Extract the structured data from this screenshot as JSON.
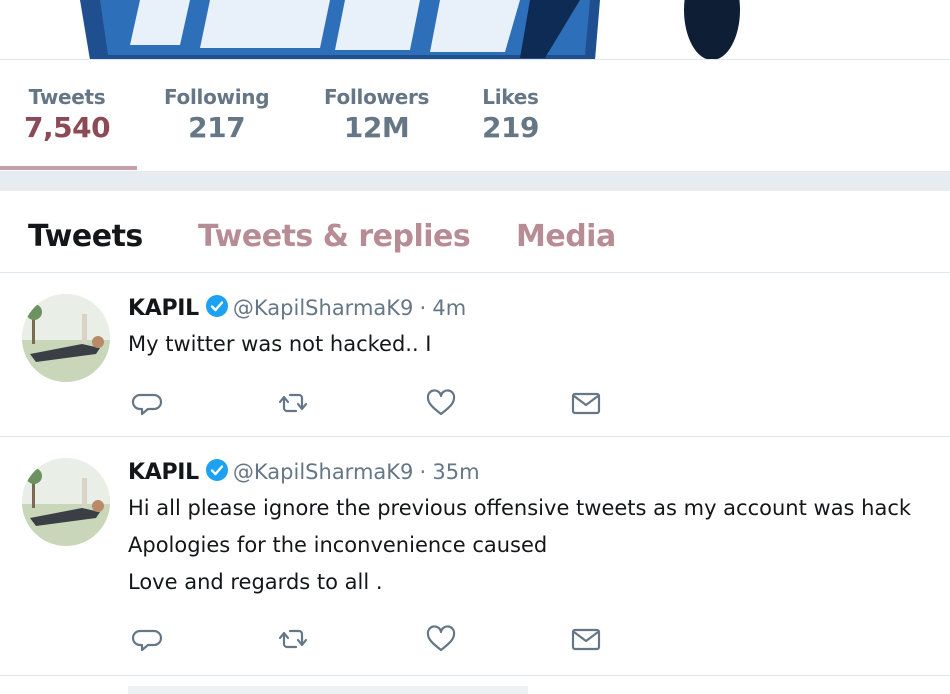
{
  "banner": {
    "alt": "profile header banner"
  },
  "stats": [
    {
      "label": "Tweets",
      "value": "7,540",
      "active": true
    },
    {
      "label": "Following",
      "value": "217",
      "active": false
    },
    {
      "label": "Followers",
      "value": "12M",
      "active": false
    },
    {
      "label": "Likes",
      "value": "219",
      "active": false
    }
  ],
  "tabs": [
    {
      "label": "Tweets",
      "active": true
    },
    {
      "label": "Tweets & replies",
      "active": false
    },
    {
      "label": "Media",
      "active": false
    }
  ],
  "tweets": [
    {
      "name": "KAPIL",
      "handle": "@KapilSharmaK9",
      "separator": "·",
      "time": "4m",
      "lines": [
        "My twitter was not hacked.. I"
      ]
    },
    {
      "name": "KAPIL",
      "handle": "@KapilSharmaK9",
      "separator": "·",
      "time": "35m",
      "lines": [
        "Hi all please ignore the previous offensive tweets as my account was hack",
        "Apologies for the inconvenience caused",
        "Love and regards to all ."
      ]
    }
  ],
  "icons": {
    "reply": "reply-icon",
    "retweet": "retweet-icon",
    "like": "heart-icon",
    "dm": "envelope-icon",
    "verified": "verified-badge-icon"
  },
  "colors": {
    "accent": "#8b4a55",
    "inactive_tab": "#b78c94",
    "muted": "#657786",
    "verified": "#1da1f2"
  }
}
